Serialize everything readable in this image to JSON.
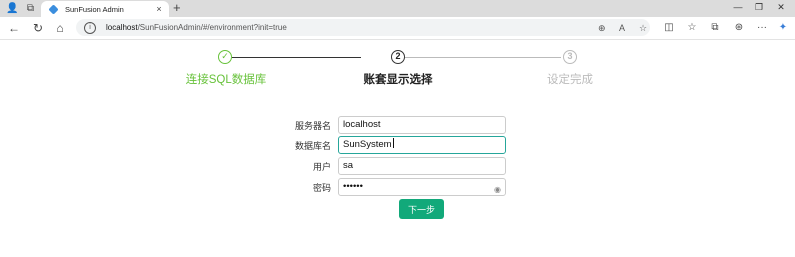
{
  "browser": {
    "tab_title": "SunFusion Admin",
    "tab_close": "×",
    "new_tab": "+",
    "url_host": "localhost",
    "url_path": "/SunFusionAdmin/#/environment?init=true",
    "window": {
      "minimize": "—",
      "restore": "❐",
      "close": "✕"
    },
    "icons": {
      "profile": "👤",
      "workspaces": "⧉",
      "back": "←",
      "refresh": "↻",
      "home": "⌂",
      "info": "i",
      "zoom": "⊕",
      "read_aloud": "A",
      "favorite": "☆",
      "split": "◫",
      "favorites": "☆",
      "collections": "⧉",
      "extensions": "⊛",
      "more": "···",
      "copilot": "✦"
    }
  },
  "stepper": {
    "steps": [
      {
        "number": "✓",
        "label": "连接SQL数据库",
        "status": "done"
      },
      {
        "number": "2",
        "label": "账套显示选择",
        "status": "active"
      },
      {
        "number": "3",
        "label": "设定完成",
        "status": "wait"
      }
    ],
    "colors": {
      "done": "#67c23a",
      "active": "#222222",
      "wait": "#bbbbbb"
    }
  },
  "form": {
    "server": {
      "label": "服务器名",
      "value": "localhost"
    },
    "database": {
      "label": "数据库名",
      "value": "SunSystem"
    },
    "user": {
      "label": "用户",
      "value": "sa"
    },
    "password": {
      "label": "密码",
      "value": "••••••"
    },
    "next_label": "下一步",
    "eye_icon": "◉"
  },
  "colors": {
    "primary": "#12a97a",
    "focus_border": "#26a69a"
  }
}
